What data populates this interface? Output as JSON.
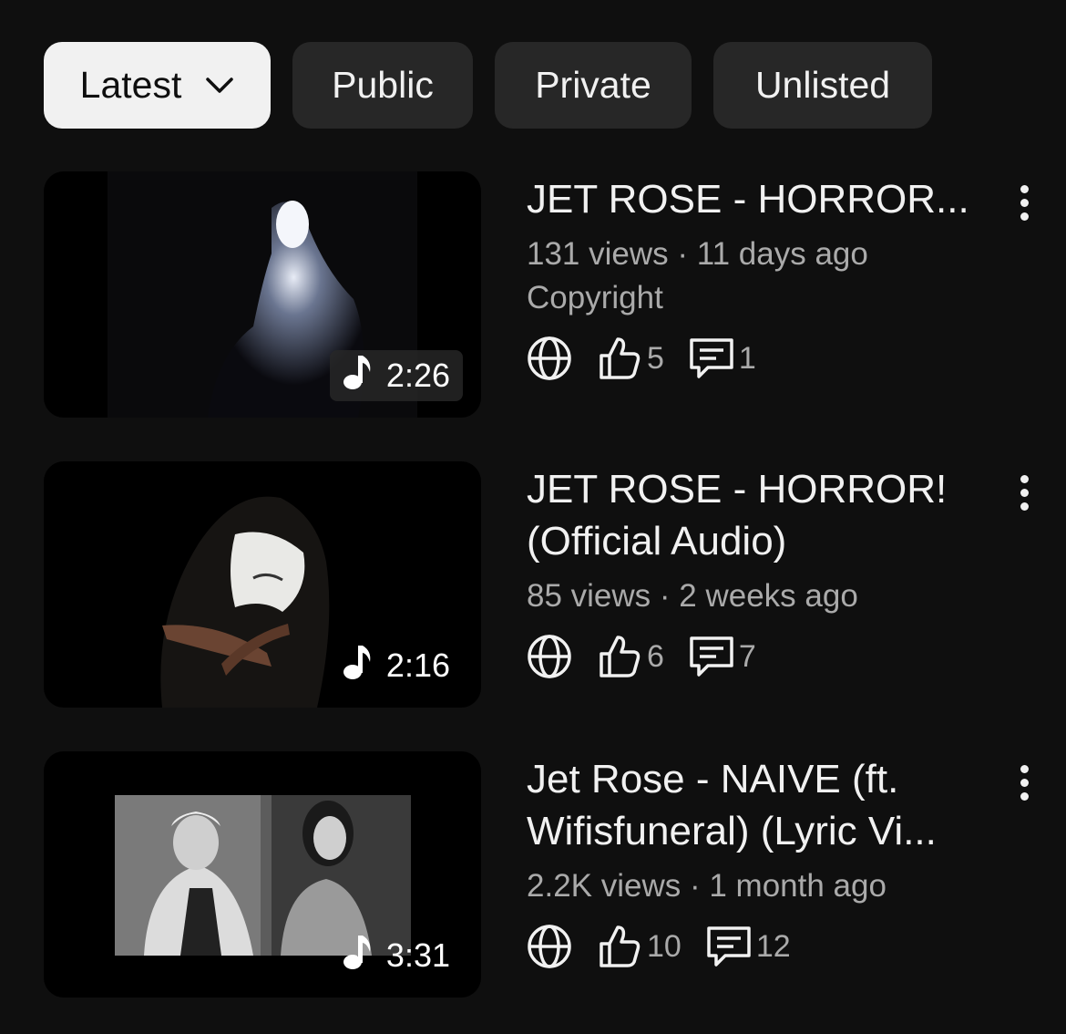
{
  "filters": [
    {
      "label": "Latest",
      "active": true,
      "icon": "chevron-down-icon"
    },
    {
      "label": "Public",
      "active": false
    },
    {
      "label": "Private",
      "active": false
    },
    {
      "label": "Unlisted",
      "active": false
    }
  ],
  "videos": [
    {
      "title": "JET ROSE - HORROR...",
      "meta": "131 views · 11 days ago",
      "note": "Copyright",
      "duration": "2:26",
      "likes": "5",
      "comments": "1"
    },
    {
      "title": "JET ROSE - HORROR! (Official Audio)",
      "meta": "85 views · 2 weeks ago",
      "duration": "2:16",
      "likes": "6",
      "comments": "7"
    },
    {
      "title": "Jet Rose - NAIVE (ft. Wifisfuneral) (Lyric Vi...",
      "meta": "2.2K views · 1 month ago",
      "duration": "3:31",
      "likes": "10",
      "comments": "12"
    }
  ],
  "colors": {
    "background": "#0f0f0f",
    "chip": "#272727",
    "chip_active": "#f1f1f1",
    "secondary_text": "#aaaaaa"
  }
}
